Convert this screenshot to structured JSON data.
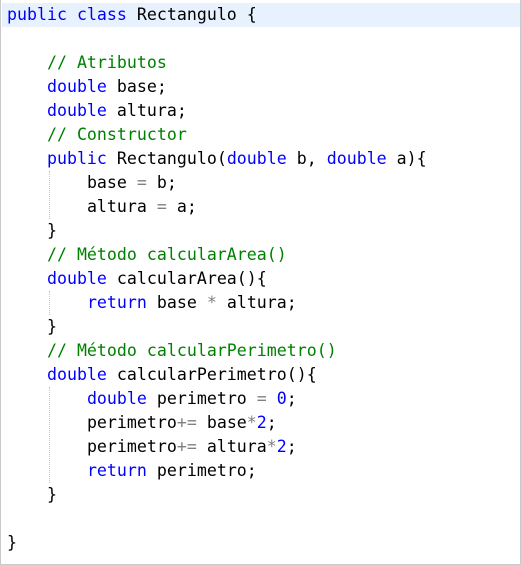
{
  "code": {
    "lines": [
      {
        "indent": 0,
        "highlight": true,
        "tokens": [
          {
            "t": "public",
            "c": "kw"
          },
          {
            "t": " ",
            "c": ""
          },
          {
            "t": "class",
            "c": "kw"
          },
          {
            "t": " Rectangulo {",
            "c": ""
          }
        ]
      },
      {
        "indent": 0,
        "tokens": []
      },
      {
        "indent": 4,
        "tokens": [
          {
            "t": "// Atributos",
            "c": "cm"
          }
        ]
      },
      {
        "indent": 4,
        "tokens": [
          {
            "t": "double",
            "c": "kw"
          },
          {
            "t": " base;",
            "c": ""
          }
        ]
      },
      {
        "indent": 4,
        "tokens": [
          {
            "t": "double",
            "c": "kw"
          },
          {
            "t": " altura;",
            "c": ""
          }
        ]
      },
      {
        "indent": 4,
        "tokens": [
          {
            "t": "// Constructor",
            "c": "cm"
          }
        ]
      },
      {
        "indent": 4,
        "tokens": [
          {
            "t": "public",
            "c": "kw"
          },
          {
            "t": " Rectangulo(",
            "c": ""
          },
          {
            "t": "double",
            "c": "kw"
          },
          {
            "t": " b, ",
            "c": ""
          },
          {
            "t": "double",
            "c": "kw"
          },
          {
            "t": " a){",
            "c": ""
          }
        ]
      },
      {
        "indent": 8,
        "tokens": [
          {
            "t": "base ",
            "c": ""
          },
          {
            "t": "=",
            "c": "op"
          },
          {
            "t": " b;",
            "c": ""
          }
        ]
      },
      {
        "indent": 8,
        "tokens": [
          {
            "t": "altura ",
            "c": ""
          },
          {
            "t": "=",
            "c": "op"
          },
          {
            "t": " a;",
            "c": ""
          }
        ]
      },
      {
        "indent": 4,
        "tokens": [
          {
            "t": "}",
            "c": ""
          }
        ]
      },
      {
        "indent": 4,
        "tokens": [
          {
            "t": "// Método calcularArea()",
            "c": "cm"
          }
        ]
      },
      {
        "indent": 4,
        "tokens": [
          {
            "t": "double",
            "c": "kw"
          },
          {
            "t": " calcularArea(){",
            "c": ""
          }
        ]
      },
      {
        "indent": 8,
        "tokens": [
          {
            "t": "return",
            "c": "kw"
          },
          {
            "t": " base ",
            "c": ""
          },
          {
            "t": "*",
            "c": "op"
          },
          {
            "t": " altura;",
            "c": ""
          }
        ]
      },
      {
        "indent": 4,
        "tokens": [
          {
            "t": "}",
            "c": ""
          }
        ]
      },
      {
        "indent": 4,
        "tokens": [
          {
            "t": "// Método calcularPerimetro()",
            "c": "cm"
          }
        ]
      },
      {
        "indent": 4,
        "tokens": [
          {
            "t": "double",
            "c": "kw"
          },
          {
            "t": " calcularPerimetro(){",
            "c": ""
          }
        ]
      },
      {
        "indent": 8,
        "tokens": [
          {
            "t": "double",
            "c": "kw"
          },
          {
            "t": " perimetro ",
            "c": ""
          },
          {
            "t": "=",
            "c": "op"
          },
          {
            "t": " ",
            "c": ""
          },
          {
            "t": "0",
            "c": "num"
          },
          {
            "t": ";",
            "c": ""
          }
        ]
      },
      {
        "indent": 8,
        "tokens": [
          {
            "t": "perimetro",
            "c": ""
          },
          {
            "t": "+=",
            "c": "op"
          },
          {
            "t": " base",
            "c": ""
          },
          {
            "t": "*",
            "c": "op"
          },
          {
            "t": "2",
            "c": "num"
          },
          {
            "t": ";",
            "c": ""
          }
        ]
      },
      {
        "indent": 8,
        "tokens": [
          {
            "t": "perimetro",
            "c": ""
          },
          {
            "t": "+=",
            "c": "op"
          },
          {
            "t": " altura",
            "c": ""
          },
          {
            "t": "*",
            "c": "op"
          },
          {
            "t": "2",
            "c": "num"
          },
          {
            "t": ";",
            "c": ""
          }
        ]
      },
      {
        "indent": 8,
        "tokens": [
          {
            "t": "return",
            "c": "kw"
          },
          {
            "t": " perimetro;",
            "c": ""
          }
        ]
      },
      {
        "indent": 4,
        "tokens": [
          {
            "t": "}",
            "c": ""
          }
        ]
      },
      {
        "indent": 0,
        "tokens": []
      },
      {
        "indent": 0,
        "tokens": [
          {
            "t": "}",
            "c": ""
          }
        ]
      }
    ]
  },
  "colors": {
    "keyword": "#0000ff",
    "comment": "#008000",
    "operator": "#808080",
    "number": "#0000ff",
    "text": "#000000",
    "current_line": "#e8f2fe"
  }
}
